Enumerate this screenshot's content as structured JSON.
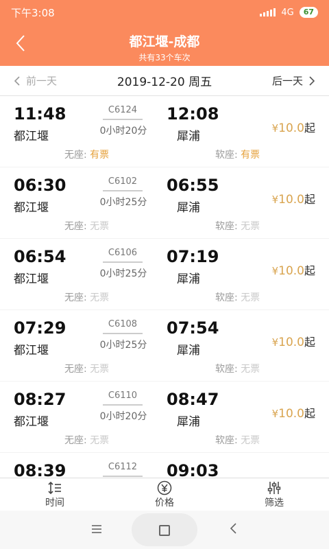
{
  "status": {
    "time": "下午3:08",
    "network": "4G",
    "battery": "67"
  },
  "header": {
    "title": "都江堰-成都",
    "subtitle": "共有33个车次",
    "back_icon": "chevron-left-icon"
  },
  "datebar": {
    "prev_label": "前一天",
    "date": "2019-12-20 周五",
    "next_label": "后一天"
  },
  "trains": [
    {
      "dep_time": "11:48",
      "dep_station": "都江堰",
      "train_no": "C6124",
      "duration": "0小时20分",
      "arr_time": "12:08",
      "arr_station": "犀浦",
      "price": "10.0",
      "seat1_label": "无座:",
      "seat1_status": "有票",
      "seat2_label": "软座:",
      "seat2_status": "有票"
    },
    {
      "dep_time": "06:30",
      "dep_station": "都江堰",
      "train_no": "C6102",
      "duration": "0小时25分",
      "arr_time": "06:55",
      "arr_station": "犀浦",
      "price": "10.0",
      "seat1_label": "无座:",
      "seat1_status": "无票",
      "seat2_label": "软座:",
      "seat2_status": "无票"
    },
    {
      "dep_time": "06:54",
      "dep_station": "都江堰",
      "train_no": "C6106",
      "duration": "0小时25分",
      "arr_time": "07:19",
      "arr_station": "犀浦",
      "price": "10.0",
      "seat1_label": "无座:",
      "seat1_status": "无票",
      "seat2_label": "软座:",
      "seat2_status": "无票"
    },
    {
      "dep_time": "07:29",
      "dep_station": "都江堰",
      "train_no": "C6108",
      "duration": "0小时25分",
      "arr_time": "07:54",
      "arr_station": "犀浦",
      "price": "10.0",
      "seat1_label": "无座:",
      "seat1_status": "无票",
      "seat2_label": "软座:",
      "seat2_status": "无票"
    },
    {
      "dep_time": "08:27",
      "dep_station": "都江堰",
      "train_no": "C6110",
      "duration": "0小时20分",
      "arr_time": "08:47",
      "arr_station": "犀浦",
      "price": "10.0",
      "seat1_label": "无座:",
      "seat1_status": "无票",
      "seat2_label": "软座:",
      "seat2_status": "无票"
    },
    {
      "dep_time": "08:39",
      "dep_station": "",
      "train_no": "C6112",
      "duration": "",
      "arr_time": "09:03",
      "arr_station": "",
      "price": "",
      "seat1_label": "",
      "seat1_status": "",
      "seat2_label": "",
      "seat2_status": ""
    }
  ],
  "price_prefix": "¥",
  "price_suffix": "起",
  "tabs": {
    "time": "时间",
    "price": "价格",
    "filter": "筛选"
  },
  "colors": {
    "brand": "#fb8a5d",
    "available": "#e6a23c",
    "price": "#d9a44f"
  }
}
